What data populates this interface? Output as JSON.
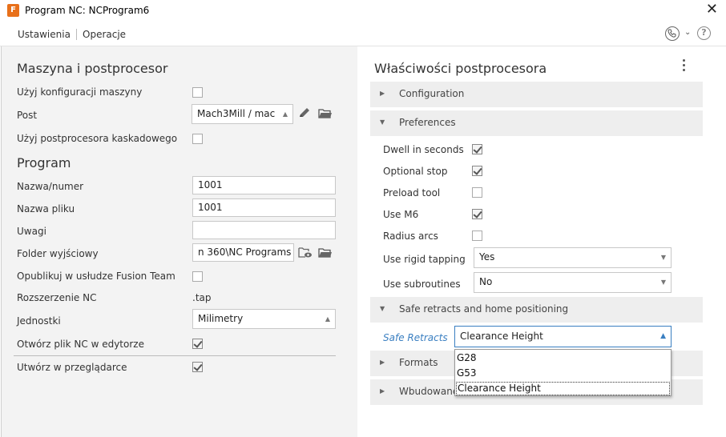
{
  "window": {
    "title": "Program NC: NCProgram6",
    "app_icon": "F"
  },
  "tabs": [
    {
      "label": "Ustawienia",
      "active": true
    },
    {
      "label": "Operacje",
      "active": false
    }
  ],
  "left": {
    "machine_section": "Maszyna i postprocesor",
    "rows": {
      "use_machine_config": {
        "label": "Użyj konfiguracji maszyny",
        "checked": false
      },
      "post": {
        "label": "Post",
        "value": "Mach3Mill / mac"
      },
      "cascade_post": {
        "label": "Użyj postprocesora kaskadowego",
        "checked": false
      }
    },
    "program_section": "Program",
    "program": {
      "name_number": {
        "label": "Nazwa/numer",
        "value": "1001"
      },
      "file_name": {
        "label": "Nazwa pliku",
        "value": "1001"
      },
      "comment": {
        "label": "Uwagi",
        "value": ""
      },
      "output_folder": {
        "label": "Folder wyjściowy",
        "value": "n 360\\NC Programs"
      },
      "publish_fusion": {
        "label": "Opublikuj w usłudze Fusion Team",
        "checked": false
      },
      "nc_extension": {
        "label": "Rozszerzenie NC",
        "value": ".tap"
      },
      "units": {
        "label": "Jednostki",
        "value": "Milimetry"
      },
      "open_in_editor": {
        "label": "Otwórz plik NC w edytorze",
        "checked": true
      },
      "create_in_browser": {
        "label": "Utwórz w przeglądarce",
        "checked": true
      }
    }
  },
  "right": {
    "title": "Właściwości postprocesora",
    "groups": {
      "configuration": {
        "label": "Configuration",
        "expanded": false
      },
      "preferences": {
        "label": "Preferences",
        "expanded": true
      },
      "safe_retracts_group": {
        "label": "Safe retracts and home positioning",
        "expanded": true
      },
      "formats": {
        "label": "Formats",
        "expanded": false
      },
      "builtin": {
        "label": "Wbudowane",
        "expanded": false
      }
    },
    "prefs": {
      "dwell_seconds": {
        "label": "Dwell in seconds",
        "checked": true
      },
      "optional_stop": {
        "label": "Optional stop",
        "checked": true
      },
      "preload_tool": {
        "label": "Preload tool",
        "checked": false
      },
      "use_m6": {
        "label": "Use M6",
        "checked": true
      },
      "radius_arcs": {
        "label": "Radius arcs",
        "checked": false
      },
      "rigid_tapping": {
        "label": "Use rigid tapping",
        "value": "Yes"
      },
      "subroutines": {
        "label": "Use subroutines",
        "value": "No"
      }
    },
    "safe_retracts": {
      "label": "Safe Retracts",
      "value": "Clearance Height",
      "options": [
        "G28",
        "G53",
        "Clearance Height"
      ]
    }
  },
  "colors": {
    "accent_blue": "#3a7fc1",
    "app_icon": "#e8701a",
    "panel_bg": "#f3f3f3",
    "group_bg": "#eeeeee"
  },
  "icons": {
    "app": "fusion-app-icon",
    "close": "close-icon",
    "phone": "phone-icon",
    "chevron": "chevron-down-icon",
    "help": "help-icon",
    "edit": "pencil-icon",
    "open_folder": "folder-icon",
    "view_folder": "folder-view-icon",
    "menu": "kebab-menu-icon"
  }
}
